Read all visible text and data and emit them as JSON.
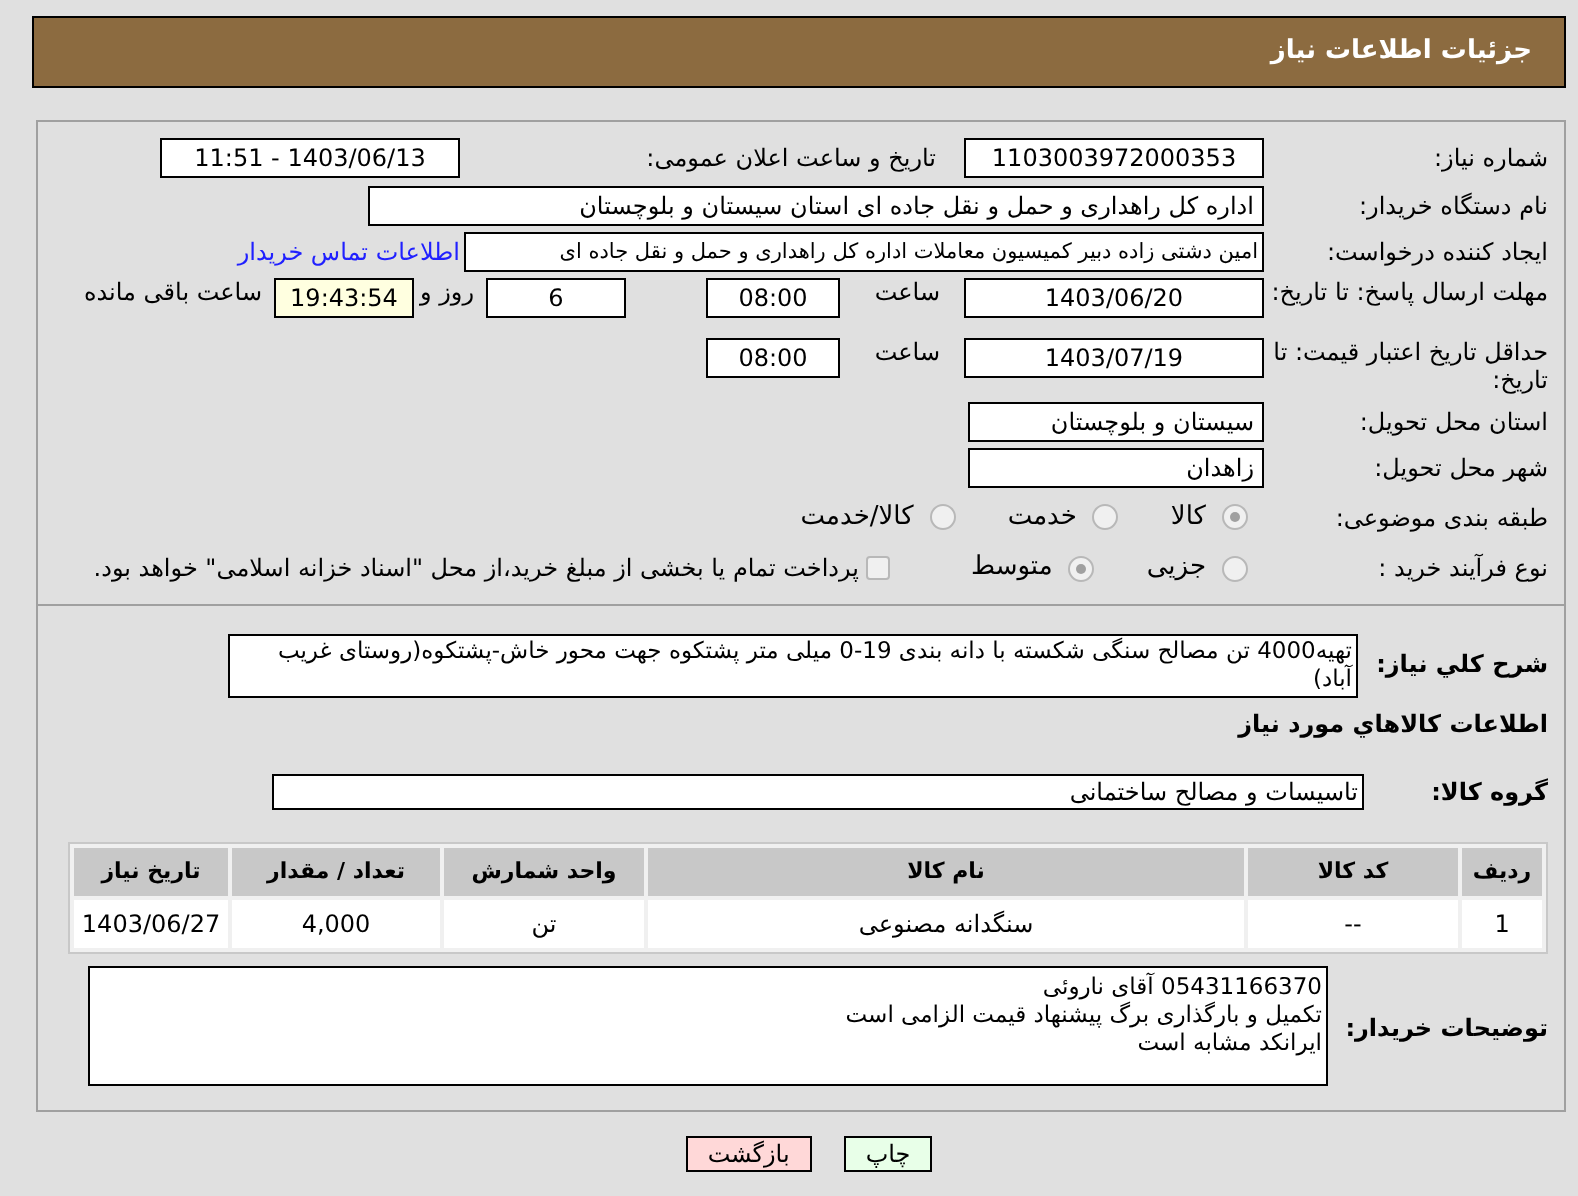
{
  "header": {
    "title": "جزئیات اطلاعات نیاز"
  },
  "need_number": {
    "label": "شماره نیاز:",
    "value": "1103003972000353"
  },
  "announce": {
    "label": "تاریخ و ساعت اعلان عمومی:",
    "value": "1403/06/13 - 11:51"
  },
  "buyer_org": {
    "label": "نام دستگاه خریدار:",
    "value": "اداره کل راهداری و حمل و نقل جاده ای استان سیستان و بلوچستان"
  },
  "requester": {
    "label": "ایجاد کننده درخواست:",
    "value": "امین دشتی زاده دبیر کمیسیون معاملات اداره کل راهداری و حمل و نقل جاده ای",
    "link": "اطلاعات تماس خریدار"
  },
  "deadline": {
    "label": "مهلت ارسال پاسخ: تا تاریخ:",
    "date": "1403/06/20",
    "time_label": "ساعت",
    "time": "08:00",
    "days": "6",
    "days_label": "روز و",
    "remaining": "19:43:54",
    "remaining_label": "ساعت باقی مانده"
  },
  "validity": {
    "label": "حداقل تاریخ اعتبار قیمت: تا تاریخ:",
    "date": "1403/07/19",
    "time_label": "ساعت",
    "time": "08:00"
  },
  "province": {
    "label": "استان محل تحویل:",
    "value": "سیستان و بلوچستان"
  },
  "city": {
    "label": "شهر محل تحویل:",
    "value": "زاهدان"
  },
  "category": {
    "label": "طبقه بندی موضوعی:",
    "options": [
      {
        "label": "کالا",
        "selected": true
      },
      {
        "label": "خدمت",
        "selected": false
      },
      {
        "label": "کالا/خدمت",
        "selected": false
      }
    ]
  },
  "process": {
    "label": "نوع فرآیند خرید :",
    "options": [
      {
        "label": "جزیی",
        "selected": false
      },
      {
        "label": "متوسط",
        "selected": true
      }
    ],
    "payment": {
      "checked": false,
      "text": "پرداخت تمام یا بخشی از مبلغ خرید،از محل \"اسناد خزانه اسلامی\" خواهد بود."
    }
  },
  "description": {
    "label": "شرح کلي نياز:",
    "value": "تهیه4000 تن مصالح سنگی شکسته با دانه بندی 19-0 میلی متر پشتکوه جهت محور خاش-پشتکوه(روستای غریب آباد)"
  },
  "goods_title": "اطلاعات کالاهاي مورد نياز",
  "goods_group": {
    "label": "گروه کالا:",
    "value": "تاسیسات و مصالح ساختمانی"
  },
  "table": {
    "columns": [
      "ردیف",
      "کد کالا",
      "نام کالا",
      "واحد شمارش",
      "تعداد / مقدار",
      "تاریخ نیاز"
    ],
    "rows": [
      [
        "1",
        "--",
        "سنگدانه مصنوعی",
        "تن",
        "4,000",
        "1403/06/27"
      ]
    ]
  },
  "notes": {
    "label": "توضیحات خریدار:",
    "lines": [
      "05431166370 آقای ناروئی",
      "تکمیل و بارگذاری برگ پیشنهاد قیمت الزامی است",
      "ایرانکد مشابه است"
    ]
  },
  "buttons": [
    {
      "kind": "print",
      "label": "چاپ"
    },
    {
      "kind": "back",
      "label": "بازگشت"
    }
  ]
}
